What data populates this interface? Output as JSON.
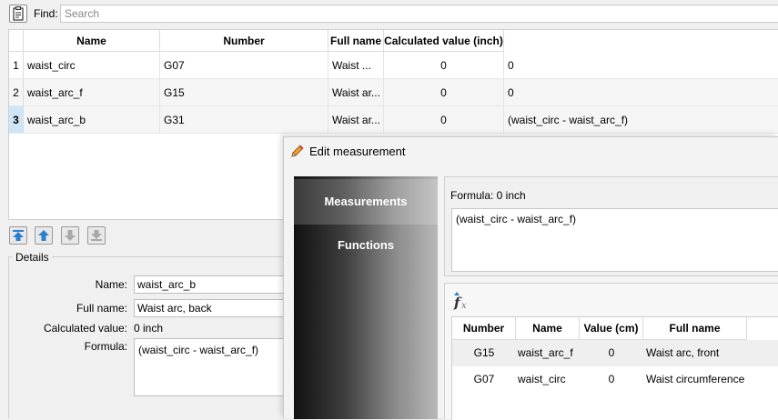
{
  "find": {
    "label": "Find:",
    "placeholder": "Search"
  },
  "table": {
    "headers": [
      "Name",
      "Number",
      "Full name",
      "Calculated value (inch)"
    ],
    "rows": [
      {
        "num": "1",
        "name": "waist_circ",
        "number": "G07",
        "full_name": "Waist ...",
        "value": "0",
        "formula": "0"
      },
      {
        "num": "2",
        "name": "waist_arc_f",
        "number": "G15",
        "full_name": "Waist ar...",
        "value": "0",
        "formula": "0"
      },
      {
        "num": "3",
        "name": "waist_arc_b",
        "number": "G31",
        "full_name": "Waist ar...",
        "value": "0",
        "formula": "(waist_circ - waist_arc_f)"
      }
    ]
  },
  "move_buttons": {
    "icons": [
      "move-top-icon",
      "move-up-icon",
      "move-down-icon",
      "move-bottom-icon"
    ]
  },
  "details": {
    "title": "Details",
    "name_label": "Name:",
    "name_value": "waist_arc_b",
    "fullname_label": "Full name:",
    "fullname_value": "Waist arc, back",
    "calc_label": "Calculated value:",
    "calc_value": "0 inch",
    "formula_label": "Formula:",
    "formula_value": "(waist_circ - waist_arc_f)"
  },
  "dialog": {
    "title": "Edit measurement",
    "sidebar": [
      "Measurements",
      "Functions"
    ],
    "formula_label": "Formula:  0 inch",
    "formula_text": "(waist_circ - waist_arc_f)",
    "func_table": {
      "headers": [
        "Number",
        "Name",
        "Value (cm)",
        "Full name"
      ],
      "rows": [
        {
          "number": "G15",
          "name": "waist_arc_f",
          "value": "0",
          "full_name": "Waist arc, front"
        },
        {
          "number": "G07",
          "name": "waist_circ",
          "value": "0",
          "full_name": "Waist circumference"
        }
      ]
    }
  },
  "colors": {
    "selected_row_number": "#cde5f7",
    "accent_blue": "#2a7fd0",
    "sidebar_dark": "#111111"
  }
}
